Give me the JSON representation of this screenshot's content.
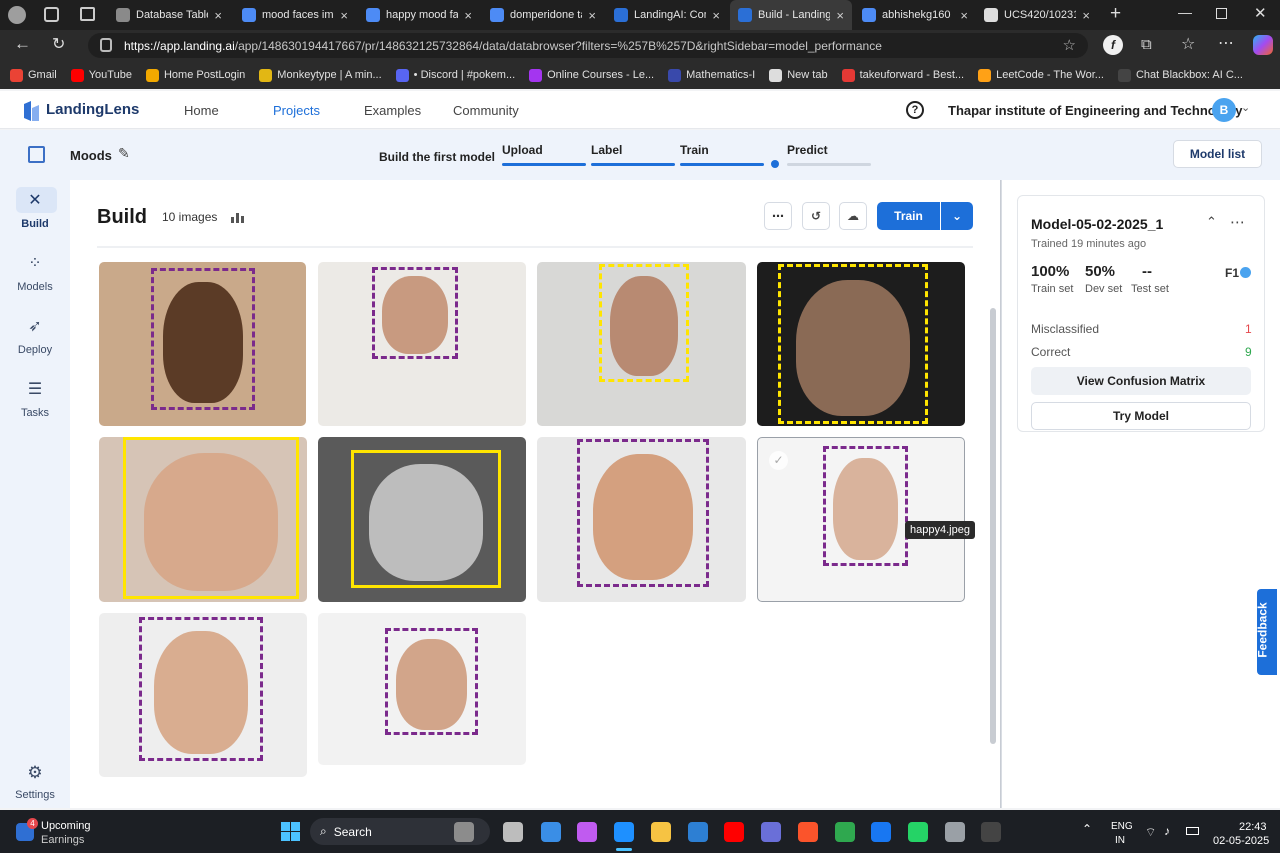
{
  "browser": {
    "tabs": [
      {
        "label": "Database Table F",
        "color": "#8a8a8a"
      },
      {
        "label": "mood faces imag",
        "color": "#4d8bf5"
      },
      {
        "label": "happy mood fac",
        "color": "#4d8bf5"
      },
      {
        "label": "domperidone tal",
        "color": "#4d8bf5"
      },
      {
        "label": "LandingAI: Com",
        "color": "#2b6fd6"
      },
      {
        "label": "Build - LandingA",
        "color": "#2b6fd6"
      },
      {
        "label": "abhishekg160 -",
        "color": "#4d8bf5"
      },
      {
        "label": "UCS420/102316",
        "color": "#dddddd"
      }
    ],
    "url_host": "https://app.landing.ai",
    "url_path": "/app/148630194417667/pr/148632125732864/data/databrowser?filters=%257B%257D&rightSidebar=model_performance",
    "bookmarks": [
      {
        "label": "Gmail",
        "color": "#ea4335"
      },
      {
        "label": "YouTube",
        "color": "#ff0000"
      },
      {
        "label": "Home PostLogin",
        "color": "#f2a900"
      },
      {
        "label": "Monkeytype | A min...",
        "color": "#e2b714"
      },
      {
        "label": "• Discord | #pokem...",
        "color": "#5865f2"
      },
      {
        "label": "Online Courses - Le...",
        "color": "#a435f0"
      },
      {
        "label": "Mathematics-I",
        "color": "#3949ab"
      },
      {
        "label": "New tab",
        "color": "#dddddd"
      },
      {
        "label": "takeuforward - Best...",
        "color": "#e53935"
      },
      {
        "label": "LeetCode - The Wor...",
        "color": "#ffa116"
      },
      {
        "label": "Chat Blackbox: AI C...",
        "color": "#444444"
      }
    ]
  },
  "app": {
    "logo": "LandingLens",
    "nav": [
      "Home",
      "Projects",
      "Examples",
      "Community"
    ],
    "org": "Thapar institute of Engineering and Technology",
    "avatar": "B",
    "project": "Moods",
    "build_label": "Build the first model",
    "steps": [
      "Upload",
      "Label",
      "Train",
      "Predict"
    ],
    "model_list": "Model list"
  },
  "rail": [
    {
      "label": "Build",
      "icon": "tools-icon"
    },
    {
      "label": "Models",
      "icon": "network-icon"
    },
    {
      "label": "Deploy",
      "icon": "rocket-icon"
    },
    {
      "label": "Tasks",
      "icon": "list-icon"
    },
    {
      "label": "Settings",
      "icon": "gear-icon"
    }
  ],
  "build": {
    "title": "Build",
    "count": "10 images",
    "train": "Train",
    "tooltip": "happy4.jpeg"
  },
  "model": {
    "name": "Model-05-02-2025_1",
    "trained": "Trained 19 minutes ago",
    "stats": [
      {
        "value": "100%",
        "label": "Train set"
      },
      {
        "value": "50%",
        "label": "Dev set"
      },
      {
        "value": "--",
        "label": "Test set"
      }
    ],
    "metric": "F1",
    "misclassified_label": "Misclassified",
    "misclassified": "1",
    "correct_label": "Correct",
    "correct": "9",
    "confusion": "View Confusion Matrix",
    "try": "Try Model",
    "colors": {
      "misclassified": "#e5484d",
      "correct": "#2fa84f"
    }
  },
  "feedback": "Feedback",
  "taskbar": {
    "badge": "4",
    "widget_title": "Upcoming",
    "widget_sub": "Earnings",
    "search": "Search",
    "lang1": "ENG",
    "lang2": "IN",
    "time": "22:43",
    "date": "02-05-2025"
  },
  "colors": {
    "accent": "#1d6fd9",
    "label_happy": "#7b2a8c",
    "label_sad": "#ffe500"
  }
}
